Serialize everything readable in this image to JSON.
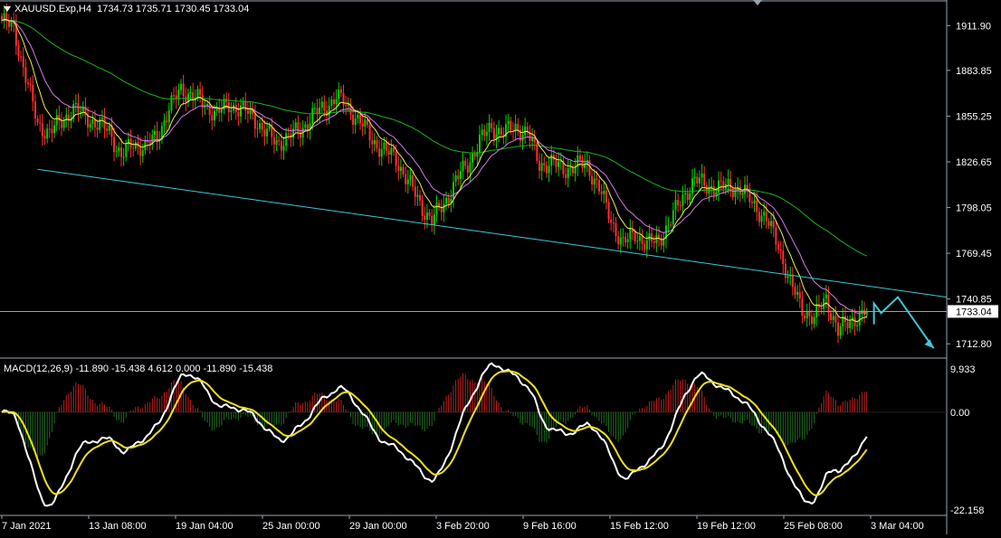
{
  "header": {
    "symbol": "XAUUSD.Exp,H4",
    "ohlc": "1734.73 1735.71 1730.45 1733.04"
  },
  "macd_header": "MACD(12,26,9) -11.890 -15.438 4.612 0.000 -11.890 -15.438",
  "price_axis": {
    "ticks": [
      "1911.90",
      "1883.85",
      "1855.25",
      "1826.65",
      "1798.05",
      "1769.45",
      "1740.85",
      "1712.80"
    ],
    "current": "1733.04"
  },
  "macd_axis": {
    "ticks": [
      "9.933",
      "0.00",
      "-22.158"
    ]
  },
  "time_axis": {
    "labels": [
      "7 Jan 2021",
      "13 Jan 08:00",
      "19 Jan 04:00",
      "25 Jan 00:00",
      "29 Jan 00:00",
      "3 Feb 20:00",
      "9 Feb 16:00",
      "15 Feb 12:00",
      "19 Feb 12:00",
      "25 Feb 08:00",
      "3 Mar 04:00"
    ]
  },
  "colors": {
    "background": "#000000",
    "bull_candle": "#00d000",
    "bear_candle": "#ff3030",
    "trendline": "#40c8d8",
    "ma_slow": "#19b519",
    "ma_mid": "#d878e8",
    "ma_fast": "#f0f050",
    "macd_line": "#ffffff",
    "signal_line": "#f0e020",
    "hist_pos": "#c02020",
    "hist_neg": "#207020",
    "grid": "#9aa4b0"
  },
  "chart_data": {
    "type": "candlestick",
    "instrument": "XAUUSD.Exp",
    "timeframe": "H4",
    "price_range": [
      1705,
      1920
    ],
    "close_path": [
      [
        0,
        1915
      ],
      [
        5,
        1910
      ],
      [
        10,
        1880
      ],
      [
        15,
        1850
      ],
      [
        20,
        1845
      ],
      [
        25,
        1852
      ],
      [
        30,
        1860
      ],
      [
        35,
        1855
      ],
      [
        40,
        1850
      ],
      [
        45,
        1846
      ],
      [
        50,
        1830
      ],
      [
        55,
        1838
      ],
      [
        60,
        1836
      ],
      [
        65,
        1842
      ],
      [
        70,
        1860
      ],
      [
        75,
        1872
      ],
      [
        80,
        1868
      ],
      [
        85,
        1862
      ],
      [
        90,
        1857
      ],
      [
        95,
        1862
      ],
      [
        100,
        1860
      ],
      [
        105,
        1855
      ],
      [
        110,
        1846
      ],
      [
        115,
        1838
      ],
      [
        120,
        1843
      ],
      [
        125,
        1846
      ],
      [
        130,
        1856
      ],
      [
        135,
        1860
      ],
      [
        140,
        1868
      ],
      [
        145,
        1860
      ],
      [
        150,
        1852
      ],
      [
        155,
        1840
      ],
      [
        160,
        1834
      ],
      [
        165,
        1828
      ],
      [
        170,
        1815
      ],
      [
        175,
        1800
      ],
      [
        180,
        1790
      ],
      [
        185,
        1800
      ],
      [
        190,
        1815
      ],
      [
        195,
        1825
      ],
      [
        200,
        1840
      ],
      [
        205,
        1848
      ],
      [
        210,
        1845
      ],
      [
        215,
        1848
      ],
      [
        220,
        1845
      ],
      [
        225,
        1825
      ],
      [
        230,
        1826
      ],
      [
        235,
        1822
      ],
      [
        240,
        1824
      ],
      [
        245,
        1825
      ],
      [
        250,
        1810
      ],
      [
        255,
        1790
      ],
      [
        260,
        1775
      ],
      [
        265,
        1782
      ],
      [
        270,
        1775
      ],
      [
        275,
        1778
      ],
      [
        280,
        1790
      ],
      [
        285,
        1805
      ],
      [
        290,
        1815
      ],
      [
        295,
        1812
      ],
      [
        300,
        1810
      ],
      [
        305,
        1812
      ],
      [
        310,
        1808
      ],
      [
        315,
        1800
      ],
      [
        320,
        1790
      ],
      [
        325,
        1775
      ],
      [
        330,
        1750
      ],
      [
        335,
        1735
      ],
      [
        340,
        1728
      ],
      [
        345,
        1742
      ],
      [
        350,
        1720
      ],
      [
        355,
        1728
      ],
      [
        360,
        1730
      ],
      [
        362,
        1733.04
      ]
    ],
    "trendline": [
      [
        0,
        1822
      ],
      [
        600,
        1742
      ]
    ],
    "current_price": 1733.04,
    "forecast_arrows": [
      [
        365,
        1738
      ],
      [
        368,
        1732
      ],
      [
        375,
        1742
      ],
      [
        390,
        1710
      ]
    ],
    "macd": {
      "params": "12,26,9",
      "main": -11.89,
      "signal": -15.438,
      "histogram": 4.612,
      "range": [
        -22.158,
        9.933
      ]
    }
  }
}
